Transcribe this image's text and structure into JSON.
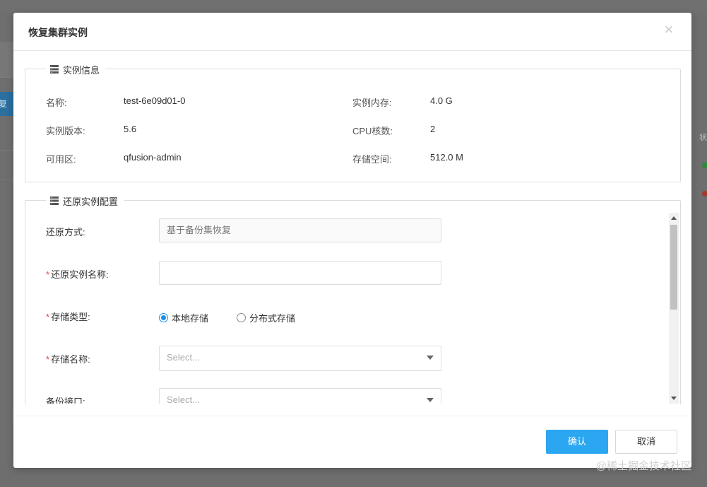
{
  "background": {
    "left_button_text": "恢复",
    "right_header_text": "状"
  },
  "modal": {
    "title": "恢复集群实例",
    "close_glyph": "×"
  },
  "instance_info": {
    "legend": "实例信息",
    "name_label": "名称:",
    "name_value": "test-6e09d01-0",
    "version_label": "实例版本:",
    "version_value": "5.6",
    "zone_label": "可用区:",
    "zone_value": "qfusion-admin",
    "memory_label": "实例内存:",
    "memory_value": "4.0 G",
    "cpu_label": "CPU核数:",
    "cpu_value": "2",
    "storage_label": "存储空间:",
    "storage_value": "512.0 M"
  },
  "restore_config": {
    "legend": "还原实例配置",
    "method_label": "还原方式:",
    "method_value": "基于备份集恢复",
    "instance_name_label": "还原实例名称:",
    "instance_name_value": "",
    "storage_type_label": "存储类型:",
    "storage_type_options": [
      "本地存储",
      "分布式存储"
    ],
    "storage_type_selected": "本地存储",
    "storage_name_label": "存储名称:",
    "storage_name_placeholder": "Select...",
    "backup_port_label": "备份接口:",
    "backup_port_placeholder": "Select..."
  },
  "footer": {
    "confirm_label": "确认",
    "cancel_label": "取消"
  },
  "watermark": "@稀土掘金技术社区",
  "colors": {
    "primary": "#2ba6f0",
    "required": "#e04b4b",
    "radio_active": "#1a8fe3"
  }
}
